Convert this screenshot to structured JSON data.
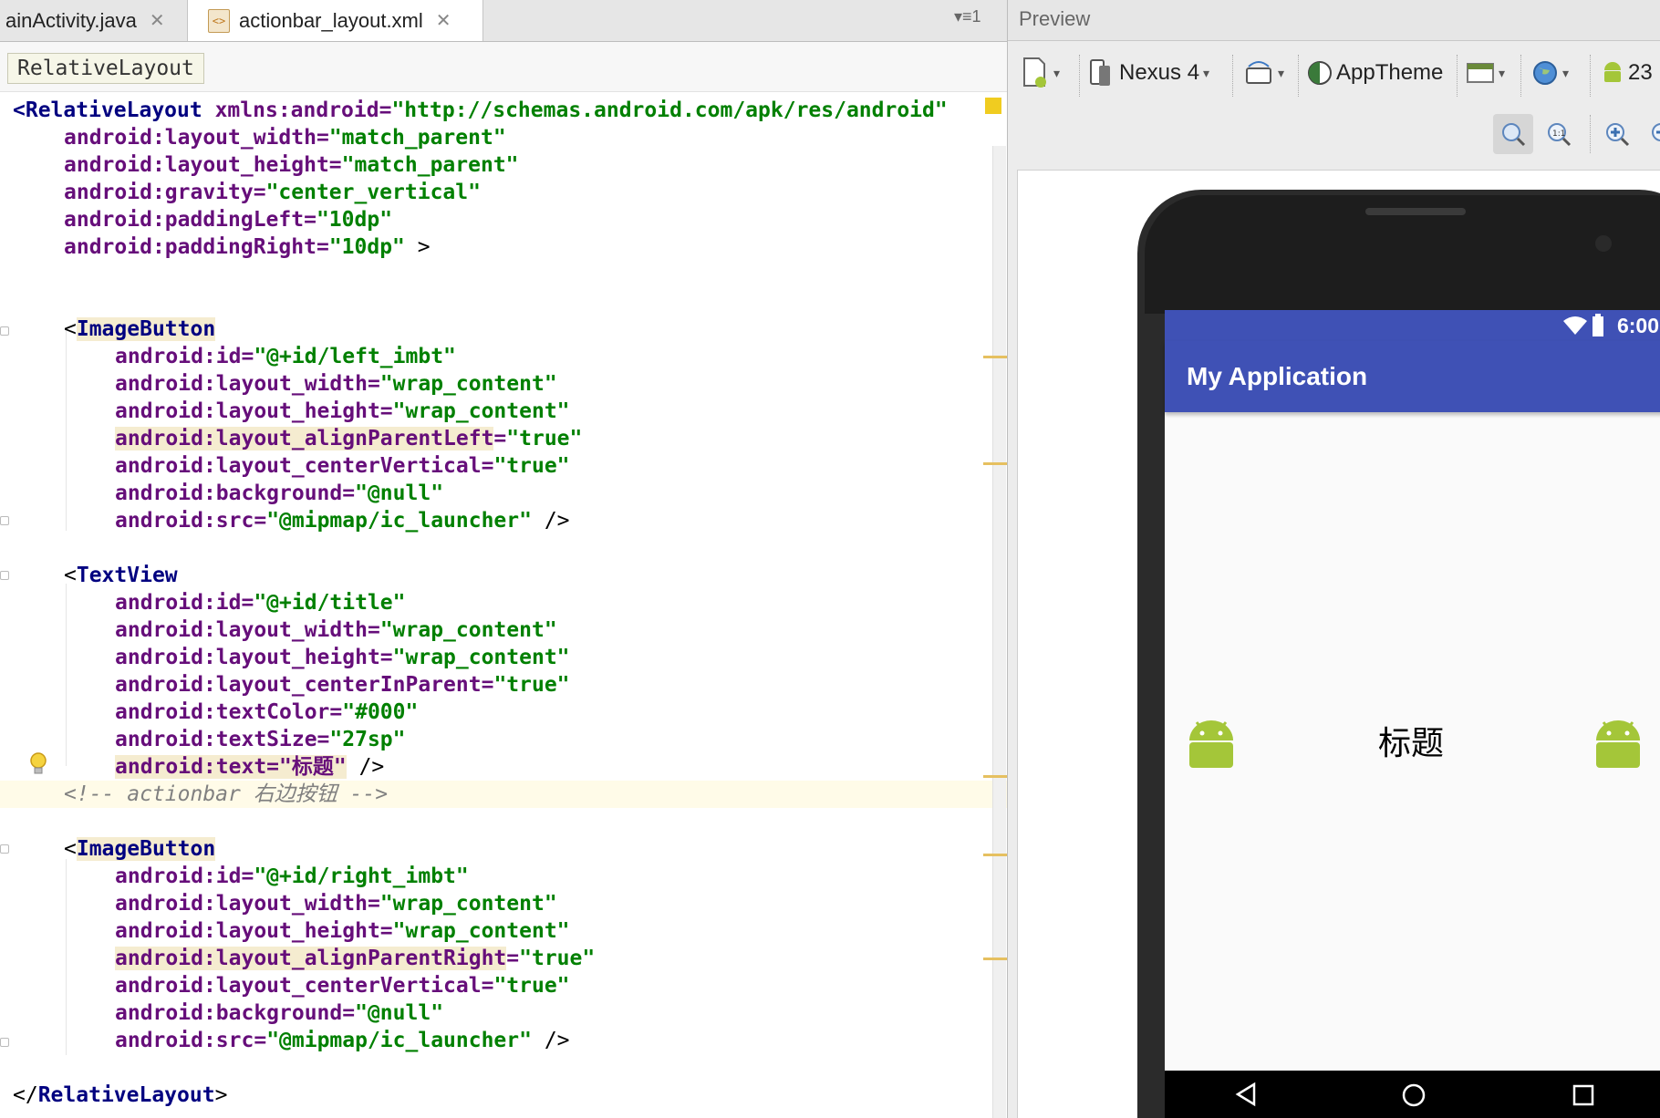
{
  "editor": {
    "tabs": [
      {
        "label": "ainActivity.java",
        "active": false
      },
      {
        "label": "actionbar_layout.xml",
        "active": true
      }
    ],
    "overflow_label": "1",
    "breadcrumb": "RelativeLayout"
  },
  "code_lines": [
    [
      "<",
      "RelativeLayout",
      " xmlns:android=",
      "\"http://schemas.android.com/apk/res/android\""
    ],
    [
      "android",
      ":layout_width=",
      "\"match_parent\""
    ],
    [
      "android",
      ":layout_height=",
      "\"match_parent\""
    ],
    [
      "android",
      ":gravity=",
      "\"center_vertical\""
    ],
    [
      "android",
      ":paddingLeft=",
      "\"10dp\""
    ],
    [
      "android",
      ":paddingRight=",
      "\"10dp\"",
      " >"
    ],
    [
      "<",
      "ImageButton"
    ],
    [
      "android",
      ":id=",
      "\"@+id/left_imbt\""
    ],
    [
      "android",
      ":layout_width=",
      "\"wrap_content\""
    ],
    [
      "android",
      ":layout_height=",
      "\"wrap_content\""
    ],
    [
      "android:layout_alignParentLeft",
      "=",
      "\"true\""
    ],
    [
      "android",
      ":layout_centerVertical=",
      "\"true\""
    ],
    [
      "android",
      ":background=",
      "\"@null\""
    ],
    [
      "android",
      ":src=",
      "\"@mipmap/ic_launcher\"",
      " />"
    ],
    [
      "<",
      "TextView"
    ],
    [
      "android",
      ":id=",
      "\"@+id/title\""
    ],
    [
      "android",
      ":layout_width=",
      "\"wrap_content\""
    ],
    [
      "android",
      ":layout_height=",
      "\"wrap_content\""
    ],
    [
      "android",
      ":layout_centerInParent=",
      "\"true\""
    ],
    [
      "android",
      ":textColor=",
      "\"#000\""
    ],
    [
      "android",
      ":textSize=",
      "\"27sp\""
    ],
    [
      "android:text=\"标题\"",
      " />"
    ],
    [
      "<!-- actionbar 右边按钮 -->"
    ],
    [
      "<",
      "ImageButton"
    ],
    [
      "android",
      ":id=",
      "\"@+id/right_imbt\""
    ],
    [
      "android",
      ":layout_width=",
      "\"wrap_content\""
    ],
    [
      "android",
      ":layout_height=",
      "\"wrap_content\""
    ],
    [
      "android:layout_alignParentRight",
      "=",
      "\"true\""
    ],
    [
      "android",
      ":layout_centerVertical=",
      "\"true\""
    ],
    [
      "android",
      ":background=",
      "\"@null\""
    ],
    [
      "android",
      ":src=",
      "\"@mipmap/ic_launcher\"",
      " />"
    ],
    [
      "</",
      "RelativeLayout",
      ">"
    ]
  ],
  "preview": {
    "title": "Preview",
    "device_label": "Nexus 4",
    "theme_label": "AppTheme",
    "api_label": "23",
    "app": {
      "status_time": "6:00",
      "app_title": "My Application",
      "center_text": "标题"
    }
  },
  "colors": {
    "app_primary": "#3f51b5",
    "xml_tag": "#000080",
    "xml_attr": "#660e7a",
    "xml_value": "#008000",
    "android_green": "#a4c639"
  }
}
